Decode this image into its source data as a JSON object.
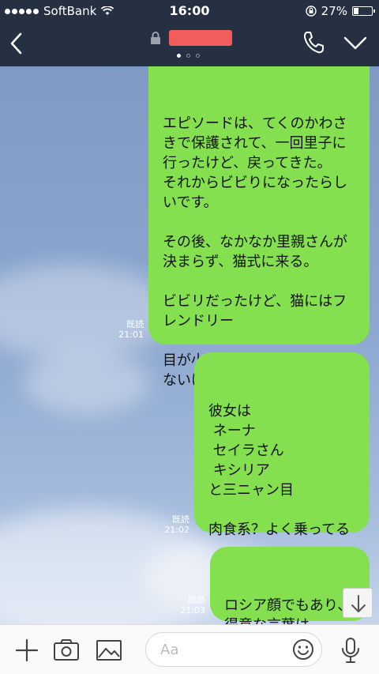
{
  "status": {
    "carrier": "SoftBank",
    "time": "16:00",
    "battery": "27%",
    "battery_level": 0.27
  },
  "nav": {
    "back_icon": "chevron-left-icon",
    "lock_icon": "lock-icon",
    "phone_icon": "phone-icon",
    "menu_icon": "chevron-down-icon",
    "page_count": 3,
    "active_page": 1
  },
  "messages": [
    {
      "text": "エピソードは、てくのかわさ\nきで保護されて、一回里子に\n行ったけど、戻ってきた。\nそれからビビりになったらし\nいです。\n\nその後、なかなか里親さんが\n決まらず、猫式に来る。\n\nビビリだったけど、猫にはフ\nレンドリー\n\n目が小さくて決して美形では\nないけど、なぜかモテる",
      "read": "既読",
      "time": "21:01"
    },
    {
      "text": "彼女は\n ネーナ\n セイラさん\n キシリア\nと三ニャン目\n\n肉食系？よく乗ってる\n\nメンフクロウに似てる",
      "read": "既読",
      "time": "21:02"
    },
    {
      "text": "ロシア顔でもあり、\n得意な言葉は\nおそロシア",
      "read": "既読",
      "time": "21:03"
    }
  ],
  "input": {
    "placeholder": "Aa",
    "add_icon": "plus-icon",
    "camera_icon": "camera-icon",
    "image_icon": "image-icon",
    "emoji_icon": "emoji-icon",
    "mic_icon": "microphone-icon"
  },
  "colors": {
    "header": "#253042",
    "bubble": "#84e04f",
    "unread_title_redaction": "#f15c5c"
  }
}
